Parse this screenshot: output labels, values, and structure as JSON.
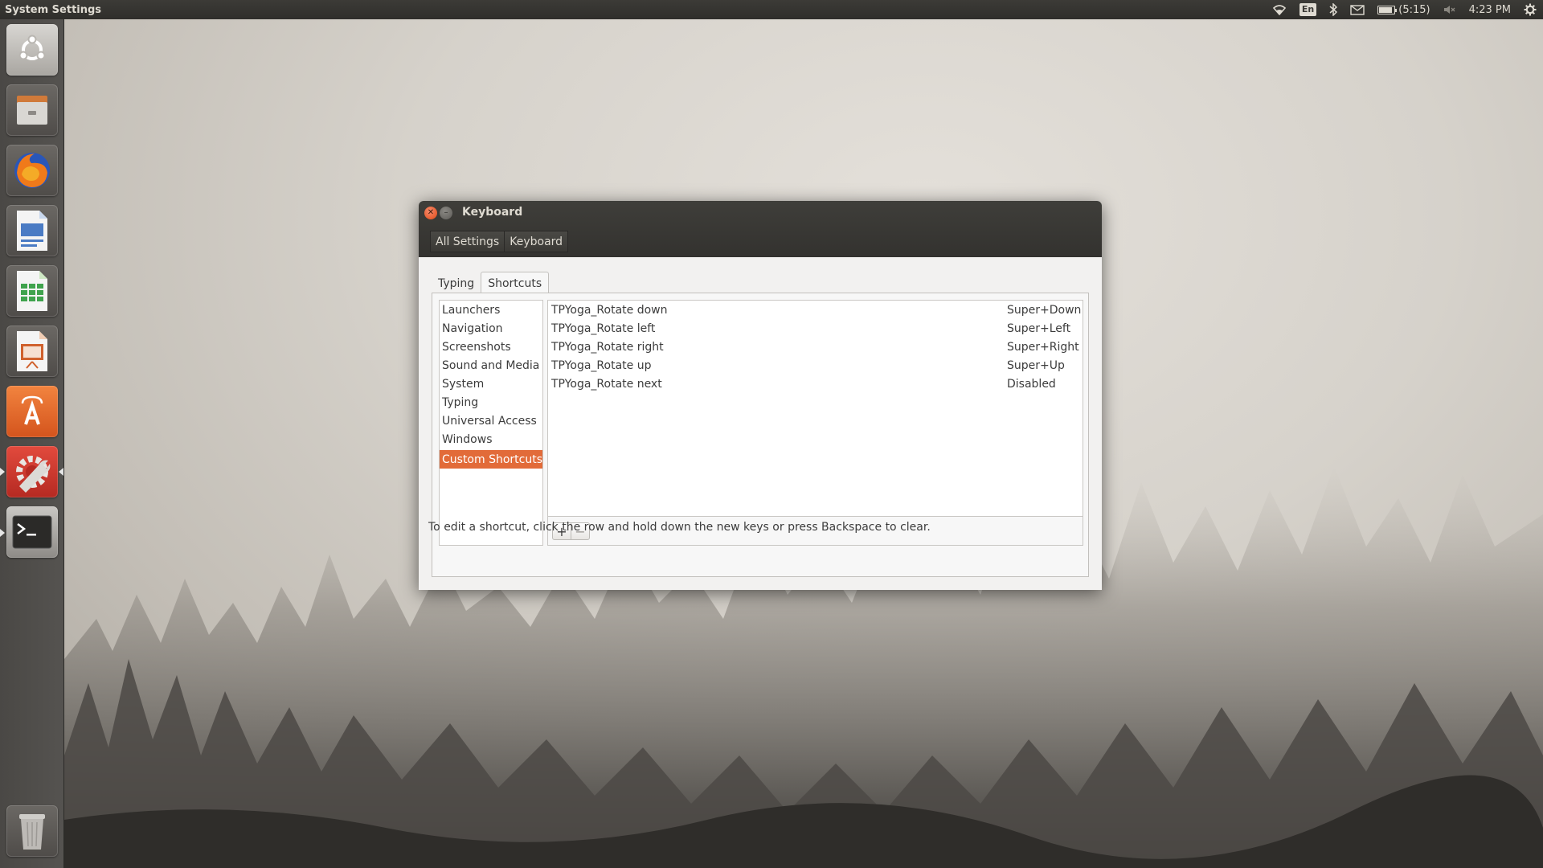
{
  "top_panel": {
    "app_title": "System Settings",
    "keyboard_layout": "En",
    "battery_time": "(5:15)",
    "clock": "4:23 PM",
    "battery_level_pct": 90
  },
  "launcher": {
    "items": [
      "ubuntu-dash",
      "files",
      "firefox",
      "libreoffice-writer",
      "libreoffice-calc",
      "libreoffice-impress",
      "ubuntu-software",
      "system-settings",
      "terminal",
      "trash"
    ]
  },
  "window": {
    "title": "Keyboard",
    "breadcrumbs": [
      "All Settings",
      "Keyboard"
    ],
    "tabs": [
      "Typing",
      "Shortcuts"
    ],
    "active_tab": "Shortcuts",
    "categories": [
      "Launchers",
      "Navigation",
      "Screenshots",
      "Sound and Media",
      "System",
      "Typing",
      "Universal Access",
      "Windows",
      "Custom Shortcuts"
    ],
    "selected_category": "Custom Shortcuts",
    "shortcuts": [
      {
        "name": "TPYoga_Rotate down",
        "accel": "Super+Down"
      },
      {
        "name": "TPYoga_Rotate left",
        "accel": "Super+Left"
      },
      {
        "name": "TPYoga_Rotate right",
        "accel": "Super+Right"
      },
      {
        "name": "TPYoga_Rotate up",
        "accel": "Super+Up"
      },
      {
        "name": "TPYoga_Rotate next",
        "accel": "Disabled"
      }
    ],
    "add_label": "+",
    "remove_label": "−",
    "hint": "To edit a shortcut, click the row and hold down the new keys or press Backspace to clear."
  },
  "colors": {
    "accent": "#e26b39",
    "panel": "#3c3b37"
  }
}
